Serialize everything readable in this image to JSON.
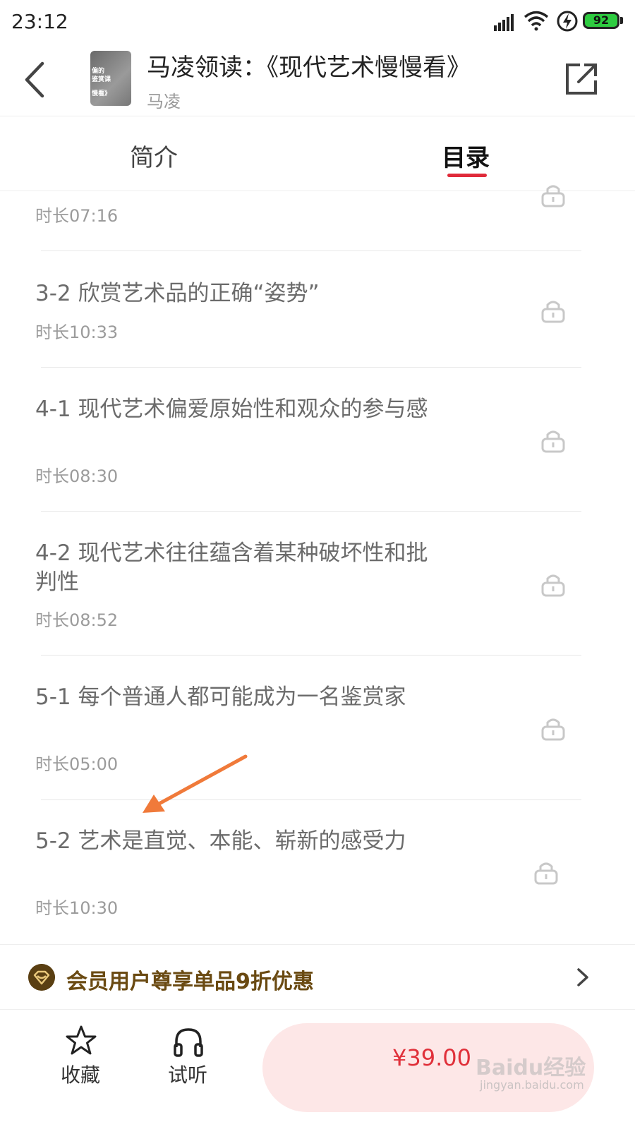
{
  "status_bar": {
    "time": "23:12",
    "battery": "92"
  },
  "header": {
    "title": "马凌领读：《现代艺术慢慢看》",
    "author": "马凌",
    "cover_text": [
      "偏的",
      "鉴赏课",
      "慢看》"
    ]
  },
  "tabs": [
    {
      "label": "简介",
      "active": false
    },
    {
      "label": "目录",
      "active": true
    }
  ],
  "chapters": [
    {
      "title": "",
      "duration": "时长07:16",
      "locked": true
    },
    {
      "title": "3-2 欣赏艺术品的正确“姿势”",
      "duration": "时长10:33",
      "locked": true
    },
    {
      "title": "4-1 现代艺术偏爱原始性和观众的参与感",
      "duration": "时长08:30",
      "locked": true
    },
    {
      "title": "4-2 现代艺术往往蕴含着某种破坏性和批判性",
      "duration": "时长08:52",
      "locked": true
    },
    {
      "title": "5-1 每个普通人都可能成为一名鉴赏家",
      "duration": "时长05:00",
      "locked": true
    },
    {
      "title": "5-2 艺术是直觉、本能、崭新的感受力",
      "duration": "时长10:30",
      "locked": true
    }
  ],
  "member_banner": {
    "text": "会员用户尊享单品9折优惠"
  },
  "bottom_bar": {
    "favorite_label": "收藏",
    "listen_label": "试听",
    "price": "¥39.00"
  },
  "watermark": {
    "text": "Baidu经验",
    "sub": "jingyan.baidu.com"
  },
  "colors": {
    "accent": "#e02a3a",
    "member_gold": "#6a4a12",
    "price_bg": "#fde7e7",
    "annotation_arrow": "#f07a3a"
  }
}
